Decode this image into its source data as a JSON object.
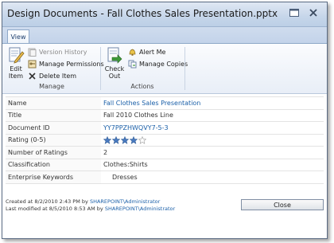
{
  "dialog": {
    "title": "Design Documents - Fall Clothes Sales Presentation.pptx"
  },
  "ribbon": {
    "tab_label": "View",
    "manage": {
      "label": "Manage",
      "edit_item": "Edit Item",
      "version_history": "Version History",
      "manage_permissions": "Manage Permissions",
      "delete_item": "Delete Item"
    },
    "actions": {
      "label": "Actions",
      "check_out": "Check Out",
      "alert_me": "Alert Me",
      "manage_copies": "Manage Copies"
    }
  },
  "properties": [
    {
      "label": "Name",
      "value": "Fall Clothes Sales Presentation",
      "link": true
    },
    {
      "label": "Title",
      "value": "Fall 2010 Clothes Line",
      "link": false
    },
    {
      "label": "Document ID",
      "value": "YY7PPZHWQVY7-5-3",
      "link": true
    },
    {
      "label": "Rating (0-5)",
      "value": "",
      "rating": 4,
      "rating_max": 5
    },
    {
      "label": "Number of Ratings",
      "value": "2",
      "link": false
    },
    {
      "label": "Classification",
      "value": "Clothes:Shirts",
      "link": false
    },
    {
      "label": "Enterprise Keywords",
      "value": "Dresses",
      "link": false,
      "indent": true
    }
  ],
  "footer": {
    "created_prefix": "Created at 8/2/2010 2:43 PM  by ",
    "created_user": "SHAREPOINT\\Administrator",
    "modified_prefix": "Last modified at 8/5/2010 8:53 AM  by ",
    "modified_user": "SHAREPOINT\\Administrator",
    "close_label": "Close"
  },
  "colors": {
    "link": "#1a5fa8",
    "star_fill": "#4a7bc0"
  }
}
